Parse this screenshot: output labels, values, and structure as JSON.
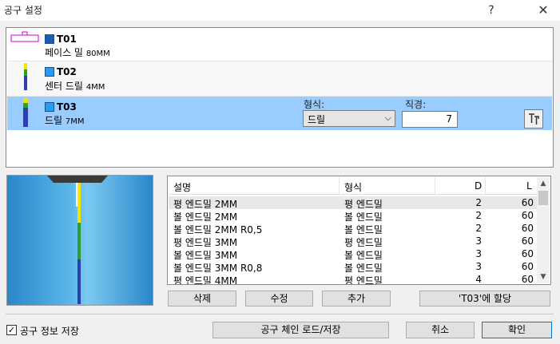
{
  "window": {
    "title": "공구 설정",
    "help_label": "?",
    "close_label": "✕"
  },
  "tools": [
    {
      "number": "T01",
      "desc_main": "페이스 밀",
      "desc_size": "80MM",
      "swatch_color": "#1a5fb4",
      "icon": "face-mill-icon"
    },
    {
      "number": "T02",
      "desc_main": "센터 드릴",
      "desc_size": "4MM",
      "swatch_color": "#2b9af3",
      "icon": "center-drill-icon"
    },
    {
      "number": "T03",
      "desc_main": "드릴",
      "desc_size": "7MM",
      "swatch_color": "#2b9af3",
      "icon": "drill-icon"
    }
  ],
  "selected_tool_fields": {
    "type_label": "형식:",
    "type_value": "드릴",
    "dia_label": "직경:",
    "dia_value": "7"
  },
  "library": {
    "headers": {
      "name": "설명",
      "type": "형식",
      "d": "D",
      "l": "L"
    },
    "rows": [
      {
        "name": "평 엔드밀 2MM",
        "type": "평 엔드밀",
        "d": "2",
        "l": "60"
      },
      {
        "name": "볼 엔드밀 2MM",
        "type": "볼 엔드밀",
        "d": "2",
        "l": "60"
      },
      {
        "name": "볼 엔드밀 2MM R0,5",
        "type": "볼 엔드밀",
        "d": "2",
        "l": "60"
      },
      {
        "name": "평 엔드밀 3MM",
        "type": "평 엔드밀",
        "d": "3",
        "l": "60"
      },
      {
        "name": "볼 엔드밀 3MM",
        "type": "볼 엔드밀",
        "d": "3",
        "l": "60"
      },
      {
        "name": "볼 엔드밀 3MM R0,8",
        "type": "볼 엔드밀",
        "d": "3",
        "l": "60"
      },
      {
        "name": "평 엔드밀 4MM",
        "type": "평 엔드밀",
        "d": "4",
        "l": "60"
      }
    ]
  },
  "buttons": {
    "delete": "삭제",
    "edit": "수정",
    "add": "추가",
    "assign": "'T03'에 할당",
    "chain": "공구 체인 로드/저장",
    "cancel": "취소",
    "ok": "확인"
  },
  "save_tool_info": {
    "label": "공구 정보 저장",
    "checked": true
  }
}
